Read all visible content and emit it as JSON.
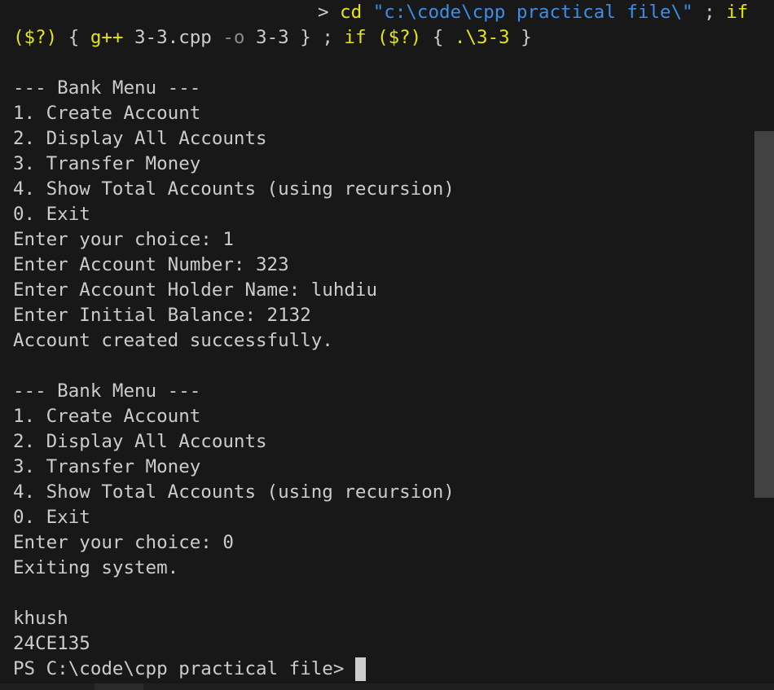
{
  "command": {
    "prompt_symbol": ">",
    "cd": "cd",
    "path_arg": "\"c:\\code\\cpp practical file\\\"",
    "semi1": ";",
    "if1": "if",
    "cond1": "($?)",
    "brace_open1": "{",
    "gpp": "g++",
    "source": "3-3.cpp",
    "flag": "-o",
    "output": "3-3",
    "brace_close1": "}",
    "semi2": ";",
    "if2": "if",
    "cond2": "($?)",
    "brace_open2": "{",
    "run": ".\\3-3",
    "brace_close2": "}"
  },
  "session1": {
    "menu_title": "--- Bank Menu ---",
    "options": [
      "1. Create Account",
      "2. Display All Accounts",
      "3. Transfer Money",
      "4. Show Total Accounts (using recursion)",
      "0. Exit"
    ],
    "choice": "Enter your choice: 1",
    "account_number": "Enter Account Number: 323",
    "holder_name": "Enter Account Holder Name: luhdiu",
    "initial_balance": "Enter Initial Balance: 2132",
    "result": "Account created successfully."
  },
  "session2": {
    "menu_title": "--- Bank Menu ---",
    "options": [
      "1. Create Account",
      "2. Display All Accounts",
      "3. Transfer Money",
      "4. Show Total Accounts (using recursion)",
      "0. Exit"
    ],
    "choice": "Enter your choice: 0",
    "result": "Exiting system."
  },
  "footer": {
    "name": "khush",
    "id": "24CE135",
    "ps_prompt": "PS C:\\code\\cpp practical file>"
  }
}
